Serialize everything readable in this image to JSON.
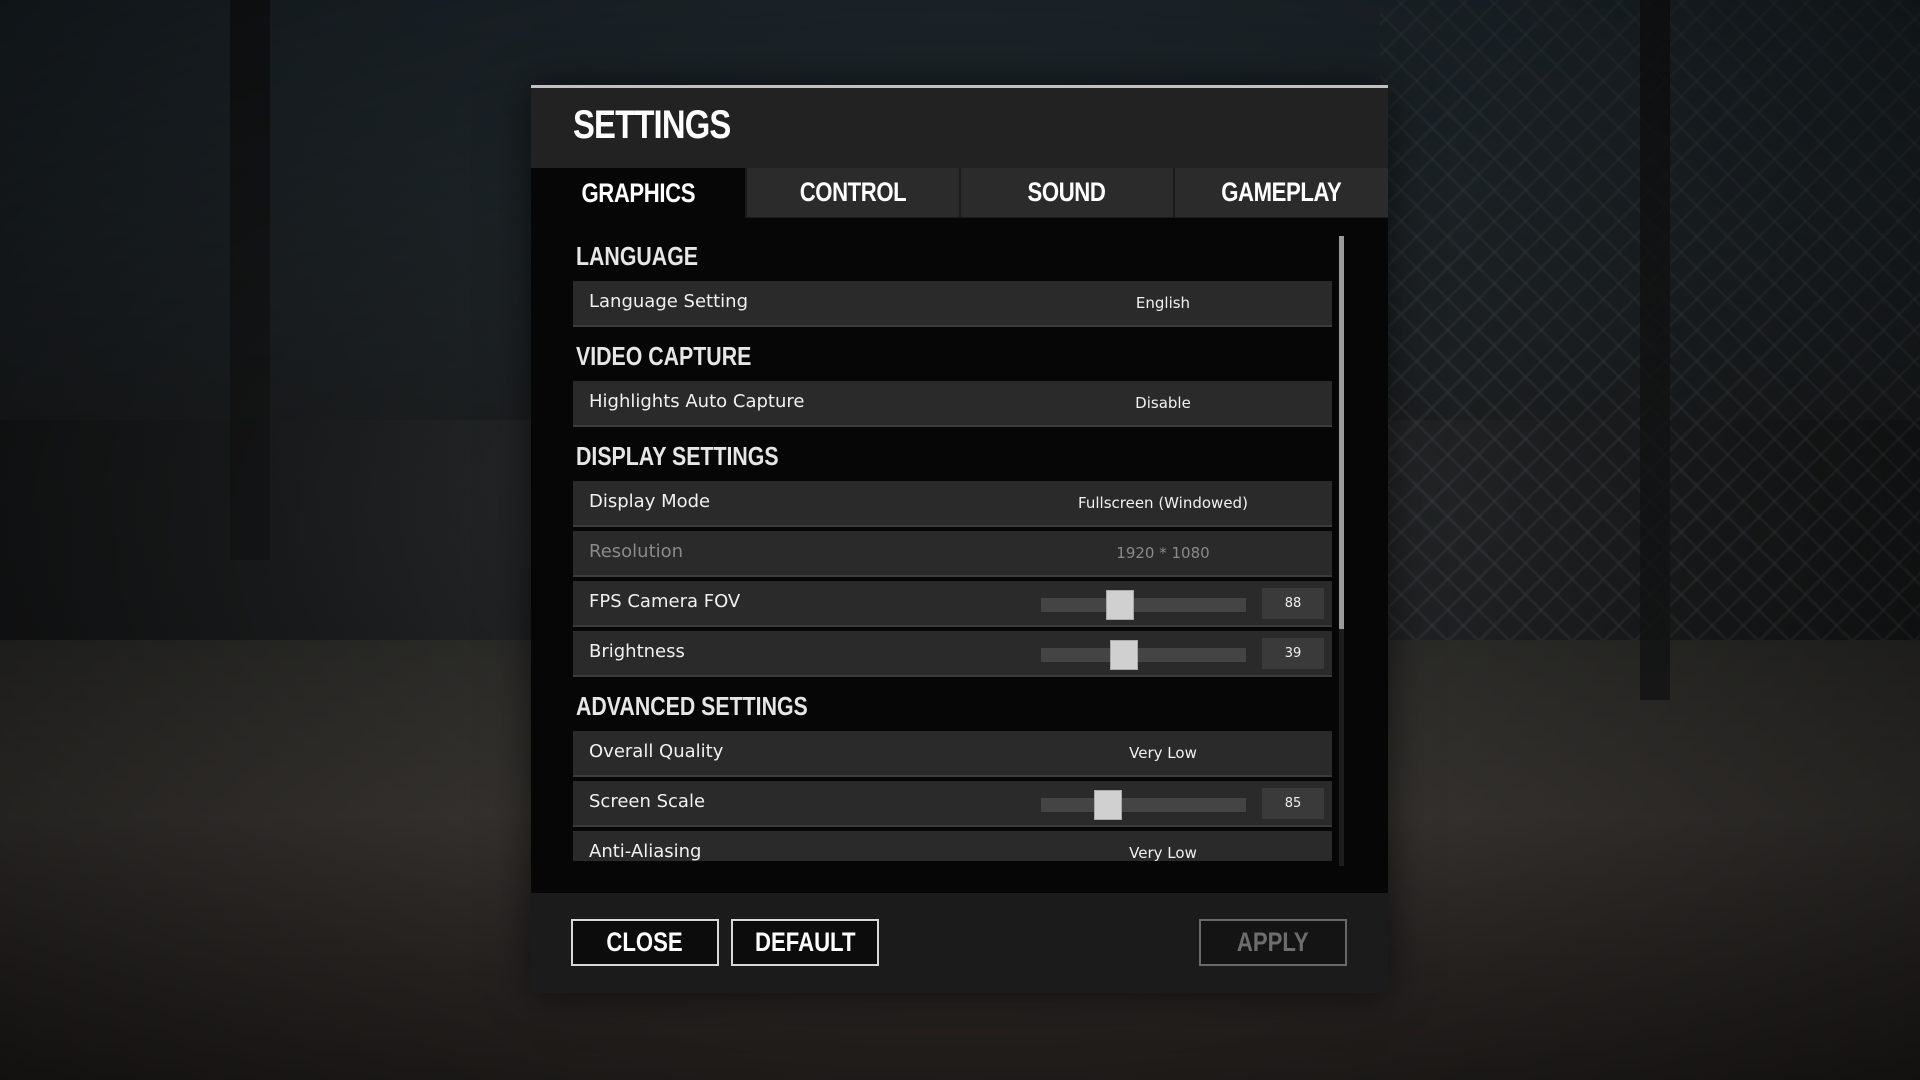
{
  "dialog": {
    "title": "SETTINGS"
  },
  "tabs": [
    {
      "label": "GRAPHICS",
      "active": true
    },
    {
      "label": "CONTROL",
      "active": false
    },
    {
      "label": "SOUND",
      "active": false
    },
    {
      "label": "GAMEPLAY",
      "active": false
    }
  ],
  "sections": {
    "language": {
      "header": "LANGUAGE",
      "language_setting": {
        "label": "Language Setting",
        "value": "English"
      }
    },
    "video_capture": {
      "header": "VIDEO CAPTURE",
      "highlights_auto_capture": {
        "label": "Highlights Auto Capture",
        "value": "Disable"
      }
    },
    "display_settings": {
      "header": "DISPLAY SETTINGS",
      "display_mode": {
        "label": "Display Mode",
        "value": "Fullscreen (Windowed)"
      },
      "resolution": {
        "label": "Resolution",
        "value": "1920 * 1080",
        "disabled": true
      },
      "fps_camera_fov": {
        "label": "FPS Camera FOV",
        "value": "88",
        "slider_fraction": 0.37
      },
      "brightness": {
        "label": "Brightness",
        "value": "39",
        "slider_fraction": 0.39
      }
    },
    "advanced_settings": {
      "header": "ADVANCED SETTINGS",
      "overall_quality": {
        "label": "Overall Quality",
        "value": "Very Low"
      },
      "screen_scale": {
        "label": "Screen Scale",
        "value": "85",
        "slider_fraction": 0.3
      },
      "anti_aliasing": {
        "label": "Anti-Aliasing",
        "value": "Very Low"
      }
    }
  },
  "footer": {
    "close_label": "CLOSE",
    "default_label": "DEFAULT",
    "apply_label": "APPLY",
    "apply_enabled": false
  }
}
